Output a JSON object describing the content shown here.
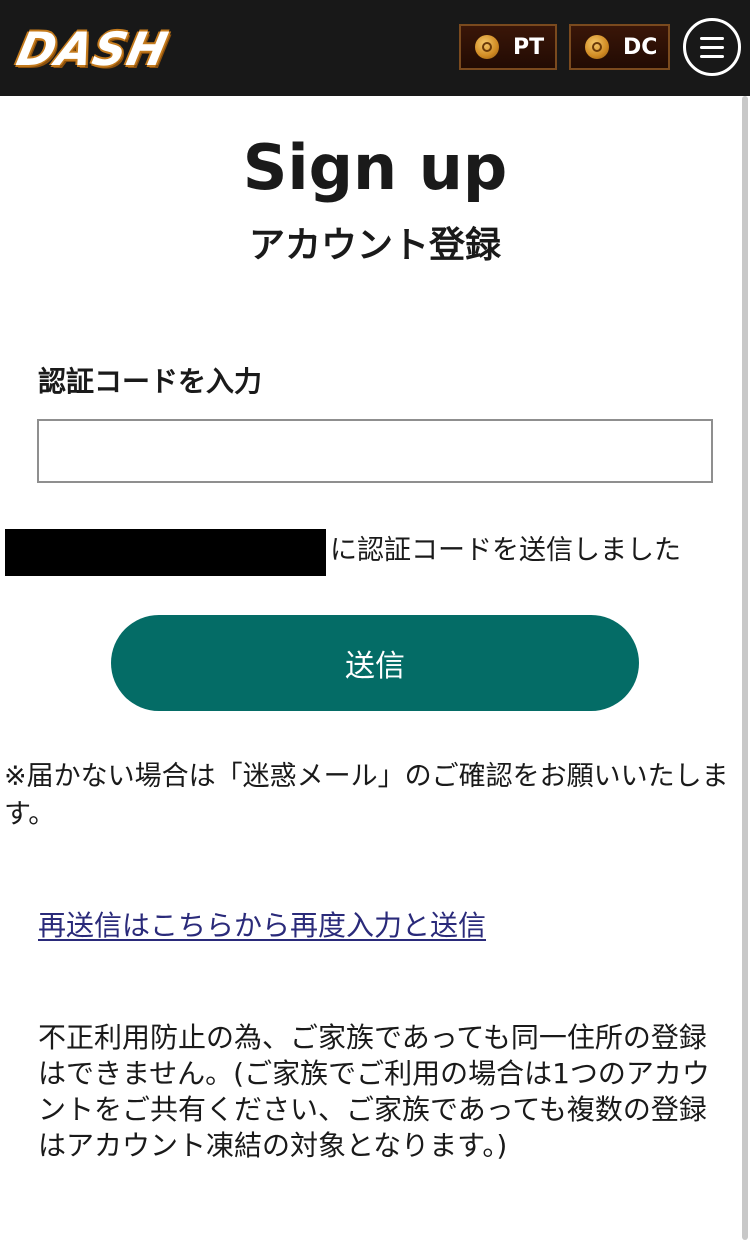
{
  "header": {
    "logo_text": "DASH",
    "points_badge": {
      "label": "PT",
      "icon": "coin-icon"
    },
    "dc_badge": {
      "label": "DC",
      "icon": "coin-icon"
    },
    "menu_icon": "hamburger-menu-icon",
    "colors": {
      "bar": "#181818",
      "logo_outline": "#c47a1c",
      "badge_bg": "#3a1608"
    }
  },
  "main": {
    "title": "Sign up",
    "subtitle": "アカウント登録",
    "code_label": "認証コードを入力",
    "code_input_value": "",
    "sent_message": "に認証コードを送信しました",
    "submit_label": "送信",
    "notice": "※届かない場合は「迷惑メール」のご確認をお願いいたします。",
    "resend_link": "再送信はこちらから再度入力と送信",
    "policy": "不正利用防止の為、ご家族であっても同一住所の登録はできません。(ご家族でご利用の場合は1つのアカウントをご共有ください、ご家族であっても複数の登録はアカウント凍結の対象となります。)",
    "colors": {
      "submit_button": "#046c66",
      "link": "#2a2a7a"
    }
  }
}
